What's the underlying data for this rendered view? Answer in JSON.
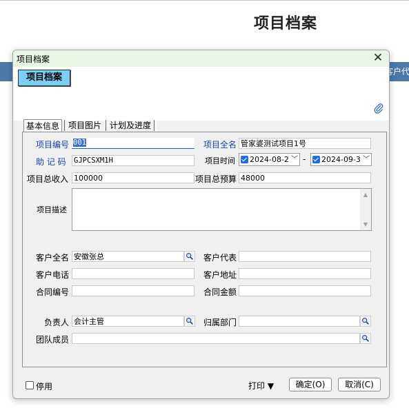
{
  "background": {
    "page_title": "项目档案",
    "bar_text": "客户代"
  },
  "dialog": {
    "title": "项目档案",
    "close_glyph": "✕",
    "header_button": "项目档案",
    "tabs": [
      "基本信息",
      "项目图片",
      "计划及进度"
    ],
    "fields": {
      "project_code": {
        "label": "项目编号",
        "value": "001"
      },
      "project_fullname": {
        "label": "项目全名",
        "value": "管家婆测试项目1号"
      },
      "mnemonic": {
        "label": "助 记 码",
        "value": "GJPCSXM1H"
      },
      "project_time": {
        "label": "项目时间",
        "start": "2024-08-2",
        "end": "2024-09-3",
        "separator": "-"
      },
      "total_income": {
        "label": "项目总收入",
        "value": "100000"
      },
      "total_budget": {
        "label": "项目总预算",
        "value": "48000"
      },
      "description": {
        "label": "项目描述",
        "value": ""
      },
      "customer_fullname": {
        "label": "客户全名",
        "value": "安徽张总"
      },
      "customer_rep": {
        "label": "客户代表",
        "value": ""
      },
      "customer_phone": {
        "label": "客户电话",
        "value": ""
      },
      "customer_address": {
        "label": "客户地址",
        "value": ""
      },
      "contract_no": {
        "label": "合同编号",
        "value": ""
      },
      "contract_amount": {
        "label": "合同金额",
        "value": ""
      },
      "owner": {
        "label": "负责人",
        "value": "会计主管"
      },
      "department": {
        "label": "归属部门",
        "value": ""
      },
      "team_members": {
        "label": "团队成员",
        "value": ""
      }
    },
    "footer": {
      "disable_label": "停用",
      "disable_checked": false,
      "print_label": "打印 ▼",
      "ok_label": "确定(O)",
      "cancel_label": "取消(C)"
    },
    "icons": {
      "search": "magnifier-icon",
      "attach": "paperclip-icon"
    },
    "colors": {
      "title_bar": "#e8f4e4",
      "header_button": "#7ccff3",
      "label_blue": "#1f3fb0",
      "selection": "#3d6fd6",
      "bg_bar": "#4d79a8"
    }
  }
}
